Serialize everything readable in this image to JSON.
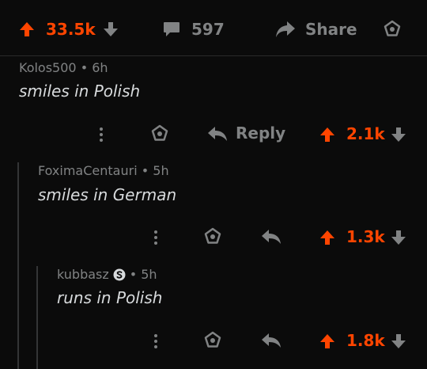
{
  "post_actions": {
    "upvotes": "33.5k",
    "comments": "597",
    "share_label": "Share"
  },
  "comments": [
    {
      "author": "Kolos500",
      "age": "6h",
      "text": "smiles in Polish",
      "reply_label": "Reply",
      "score": "2.1k"
    },
    {
      "author": "FoximaCentauri",
      "age": "5h",
      "text": "smiles in German",
      "score": "1.3k"
    },
    {
      "author": "kubbasz",
      "age": "5h",
      "text": "runs in Polish",
      "score": "1.8k"
    }
  ],
  "separator": "•",
  "colors": {
    "upvote": "#ff4500",
    "icon": "#818384",
    "background": "#0b0b0b",
    "text": "#d7dadc",
    "thread_line": "#343536"
  },
  "icons": [
    "upvote-icon",
    "downvote-icon",
    "comment-icon",
    "share-icon",
    "award-icon",
    "more-icon",
    "reply-icon",
    "premium-badge-icon"
  ]
}
